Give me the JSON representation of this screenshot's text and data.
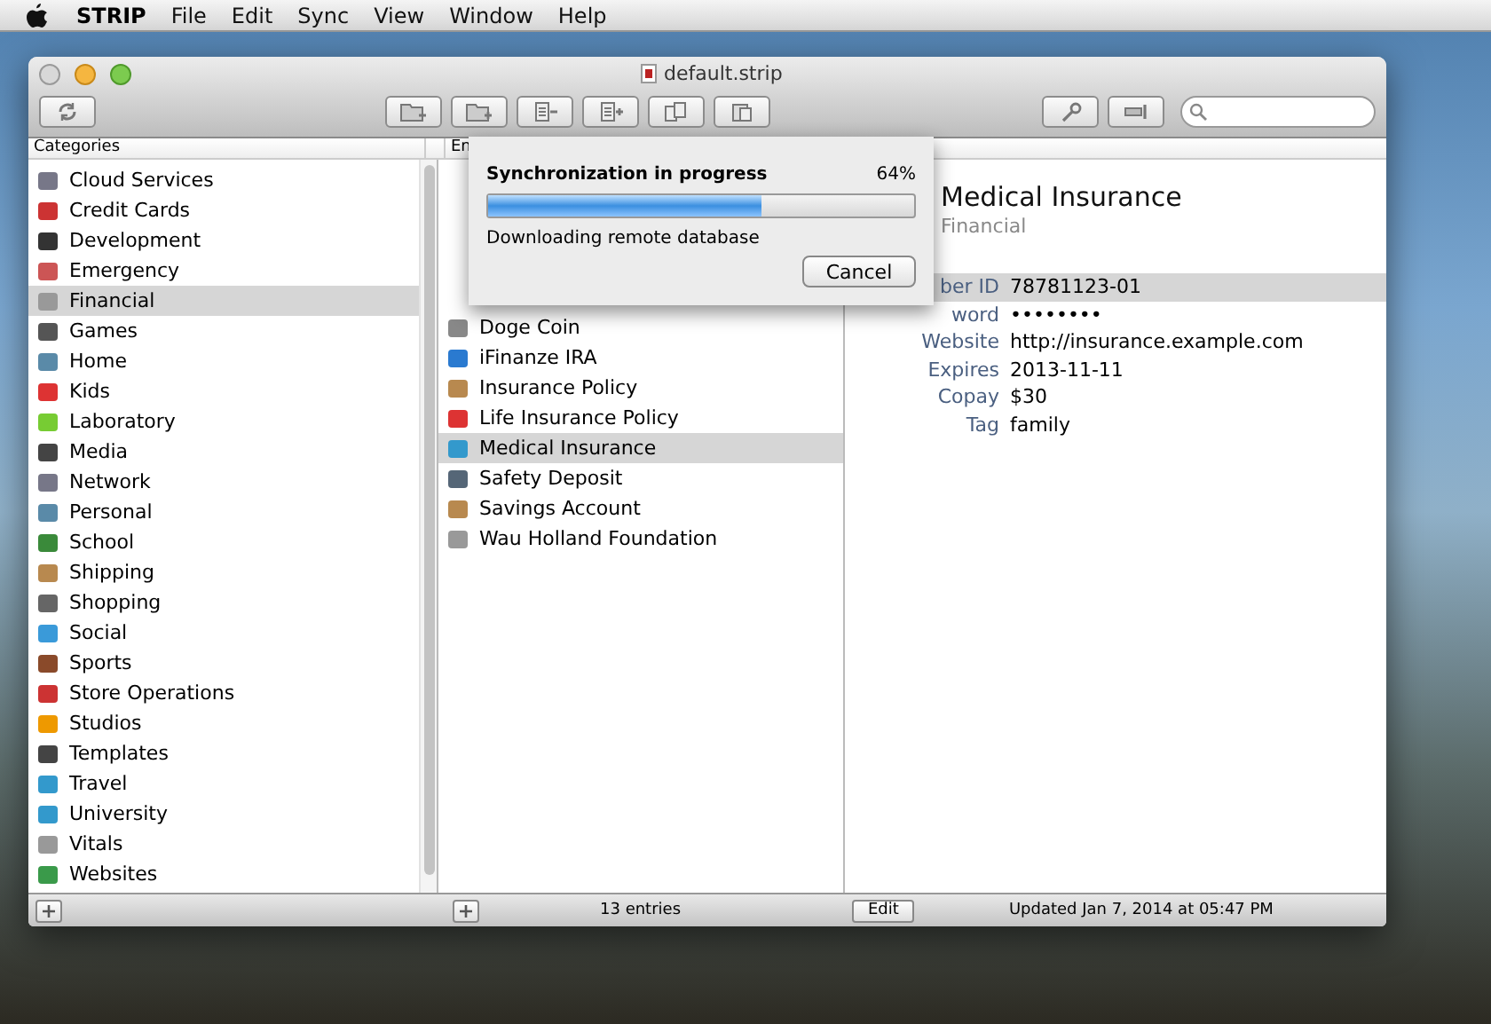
{
  "menu_bar": {
    "app_name": "STRIP",
    "menus": [
      "File",
      "Edit",
      "Sync",
      "View",
      "Window",
      "Help"
    ]
  },
  "window": {
    "title": "default.strip"
  },
  "categories": {
    "header": "Categories",
    "items": [
      {
        "label": "Cloud Services",
        "selected": false
      },
      {
        "label": "Credit Cards",
        "selected": false
      },
      {
        "label": "Development",
        "selected": false
      },
      {
        "label": "Emergency",
        "selected": false
      },
      {
        "label": "Financial",
        "selected": true
      },
      {
        "label": "Games",
        "selected": false
      },
      {
        "label": "Home",
        "selected": false
      },
      {
        "label": "Kids",
        "selected": false
      },
      {
        "label": "Laboratory",
        "selected": false
      },
      {
        "label": "Media",
        "selected": false
      },
      {
        "label": "Network",
        "selected": false
      },
      {
        "label": "Personal",
        "selected": false
      },
      {
        "label": "School",
        "selected": false
      },
      {
        "label": "Shipping",
        "selected": false
      },
      {
        "label": "Shopping",
        "selected": false
      },
      {
        "label": "Social",
        "selected": false
      },
      {
        "label": "Sports",
        "selected": false
      },
      {
        "label": "Store Operations",
        "selected": false
      },
      {
        "label": "Studios",
        "selected": false
      },
      {
        "label": "Templates",
        "selected": false
      },
      {
        "label": "Travel",
        "selected": false
      },
      {
        "label": "University",
        "selected": false
      },
      {
        "label": "Vitals",
        "selected": false
      },
      {
        "label": "Websites",
        "selected": false
      }
    ]
  },
  "entries": {
    "header": "En",
    "items": [
      {
        "label": "Doge Coin",
        "selected": false
      },
      {
        "label": "iFinanze IRA",
        "selected": false
      },
      {
        "label": "Insurance Policy",
        "selected": false
      },
      {
        "label": "Life Insurance Policy",
        "selected": false
      },
      {
        "label": "Medical Insurance",
        "selected": true
      },
      {
        "label": "Safety Deposit",
        "selected": false
      },
      {
        "label": "Savings Account",
        "selected": false
      },
      {
        "label": "Wau Holland Foundation",
        "selected": false
      }
    ],
    "count": "13 entries"
  },
  "sync_sheet": {
    "title": "Synchronization in progress",
    "percent": "64%",
    "level": 0.64,
    "message": "Downloading remote database",
    "cancel_button": "Cancel"
  },
  "details": {
    "title": "Medical Insurance",
    "category": "Financial",
    "fields": [
      {
        "label": "ber ID",
        "value": "78781123-01",
        "selected": true
      },
      {
        "label": "word",
        "value": "••••••••",
        "selected": false
      },
      {
        "label": "Website",
        "value": "http://insurance.example.com",
        "selected": false
      },
      {
        "label": "Expires",
        "value": "2013-11-11",
        "selected": false
      },
      {
        "label": "Copay",
        "value": "$30",
        "selected": false
      },
      {
        "label": "Tag",
        "value": "family",
        "selected": false
      }
    ],
    "edit_button": "Edit",
    "updated": "Updated Jan 7, 2014 at 05:47 PM"
  }
}
